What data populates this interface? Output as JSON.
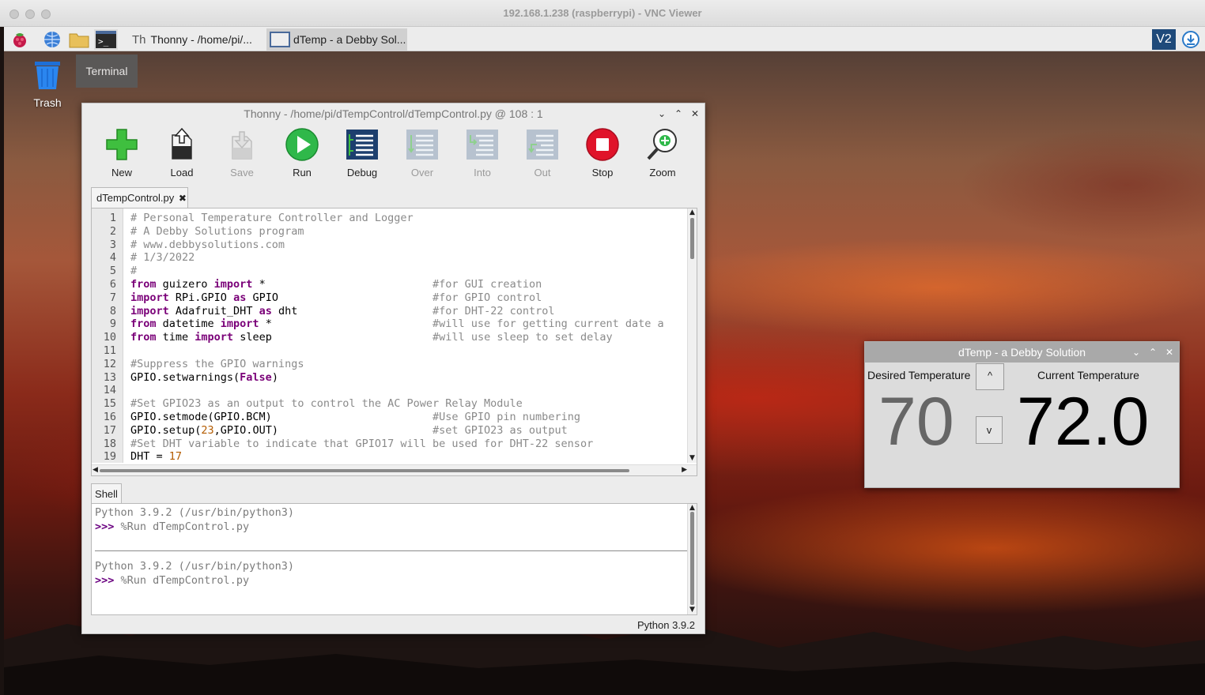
{
  "vnc": {
    "title": "192.168.1.238 (raspberrypi) - VNC Viewer"
  },
  "taskbar": {
    "items": [
      {
        "label": "Thonny  -  /home/pi/..."
      },
      {
        "label": "dTemp - a Debby Sol..."
      }
    ]
  },
  "desktop": {
    "trash_label": "Trash",
    "tooltip": "Terminal"
  },
  "thonny": {
    "title": "Thonny  -  /home/pi/dTempControl/dTempControl.py  @  108 : 1",
    "toolbar": [
      {
        "label": "New",
        "icon": "new-icon",
        "enabled": true
      },
      {
        "label": "Load",
        "icon": "load-icon",
        "enabled": true
      },
      {
        "label": "Save",
        "icon": "save-icon",
        "enabled": false
      },
      {
        "label": "Run",
        "icon": "run-icon",
        "enabled": true
      },
      {
        "label": "Debug",
        "icon": "debug-icon",
        "enabled": true
      },
      {
        "label": "Over",
        "icon": "step-over-icon",
        "enabled": false
      },
      {
        "label": "Into",
        "icon": "step-into-icon",
        "enabled": false
      },
      {
        "label": "Out",
        "icon": "step-out-icon",
        "enabled": false
      },
      {
        "label": "Stop",
        "icon": "stop-icon",
        "enabled": true
      },
      {
        "label": "Zoom",
        "icon": "zoom-icon",
        "enabled": true
      }
    ],
    "editor_tab": "dTempControl.py",
    "line_numbers": [
      "1",
      "2",
      "3",
      "4",
      "5",
      "6",
      "7",
      "8",
      "9",
      "10",
      "11",
      "12",
      "13",
      "14",
      "15",
      "16",
      "17",
      "18",
      "19"
    ],
    "code_lines": [
      "# Personal Temperature Controller and Logger",
      "# A Debby Solutions program",
      "# www.debbysolutions.com",
      "# 1/3/2022",
      "#",
      "from guizero import *                          #for GUI creation",
      "import RPi.GPIO as GPIO                        #for GPIO control",
      "import Adafruit_DHT as dht                     #for DHT-22 control",
      "from datetime import *                         #will use for getting current date a",
      "from time import sleep                         #will use sleep to set delay",
      "",
      "#Suppress the GPIO warnings",
      "GPIO.setwarnings(False)",
      "",
      "#Set GPIO23 as an output to control the AC Power Relay Module",
      "GPIO.setmode(GPIO.BCM)                         #Use GPIO pin numbering",
      "GPIO.setup(23,GPIO.OUT)                        #set GPIO23 as output",
      "#Set DHT variable to indicate that GPIO17 will be used for DHT-22 sensor",
      "DHT = 17"
    ],
    "shell_tab": "Shell",
    "shell_lines": [
      {
        "text": "Python 3.9.2 (/usr/bin/python3)"
      },
      {
        "prompt": ">>> ",
        "text": "%Run dTempControl.py"
      },
      {
        "text": "Python 3.9.2 (/usr/bin/python3)"
      },
      {
        "prompt": ">>> ",
        "text": "%Run dTempControl.py"
      }
    ],
    "status": "Python 3.9.2"
  },
  "dtemp": {
    "title": "dTemp - a Debby Solution",
    "desired_label": "Desired Temperature",
    "desired_value": "70",
    "up_label": "^",
    "down_label": "v",
    "current_label": "Current Temperature",
    "current_value": "72.0"
  },
  "colors": {
    "keyword": "#7a0078",
    "comment": "#8a8a8a",
    "number": "#b35b00",
    "prompt": "#6a0080"
  }
}
